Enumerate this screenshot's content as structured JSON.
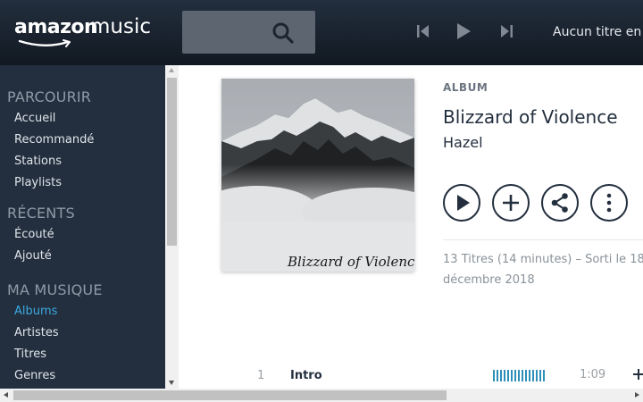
{
  "brand": {
    "amazon": "amazon",
    "music": "music",
    "accent": "#3aa8e0",
    "header_bg": "#232f3e"
  },
  "player": {
    "now_playing": "Aucun titre en"
  },
  "sidebar": {
    "sections": [
      {
        "title": "PARCOURIR",
        "items": [
          {
            "label": "Accueil"
          },
          {
            "label": "Recommandé"
          },
          {
            "label": "Stations"
          },
          {
            "label": "Playlists"
          }
        ]
      },
      {
        "title": "RÉCENTS",
        "items": [
          {
            "label": "Écouté"
          },
          {
            "label": "Ajouté"
          }
        ]
      },
      {
        "title": "MA MUSIQUE",
        "items": [
          {
            "label": "Albums",
            "active": true
          },
          {
            "label": "Artistes"
          },
          {
            "label": "Titres"
          },
          {
            "label": "Genres"
          }
        ]
      }
    ]
  },
  "album": {
    "type_label": "ALBUM",
    "title": "Blizzard of Violence",
    "artist": "Hazel",
    "cover_text": "Blizzard of Violence",
    "meta_line1": "13 Titres (14 minutes)  –  Sorti le 18",
    "meta_line2": "décembre 2018"
  },
  "tracks": [
    {
      "number": "1",
      "title": "Intro",
      "duration": "1:09"
    }
  ],
  "icons": {
    "search": "search-icon",
    "prev": "previous-track-icon",
    "play": "play-icon",
    "next": "next-track-icon",
    "album_play": "play-icon",
    "album_add": "plus-icon",
    "album_share": "share-icon",
    "album_more": "more-vertical-icon"
  }
}
